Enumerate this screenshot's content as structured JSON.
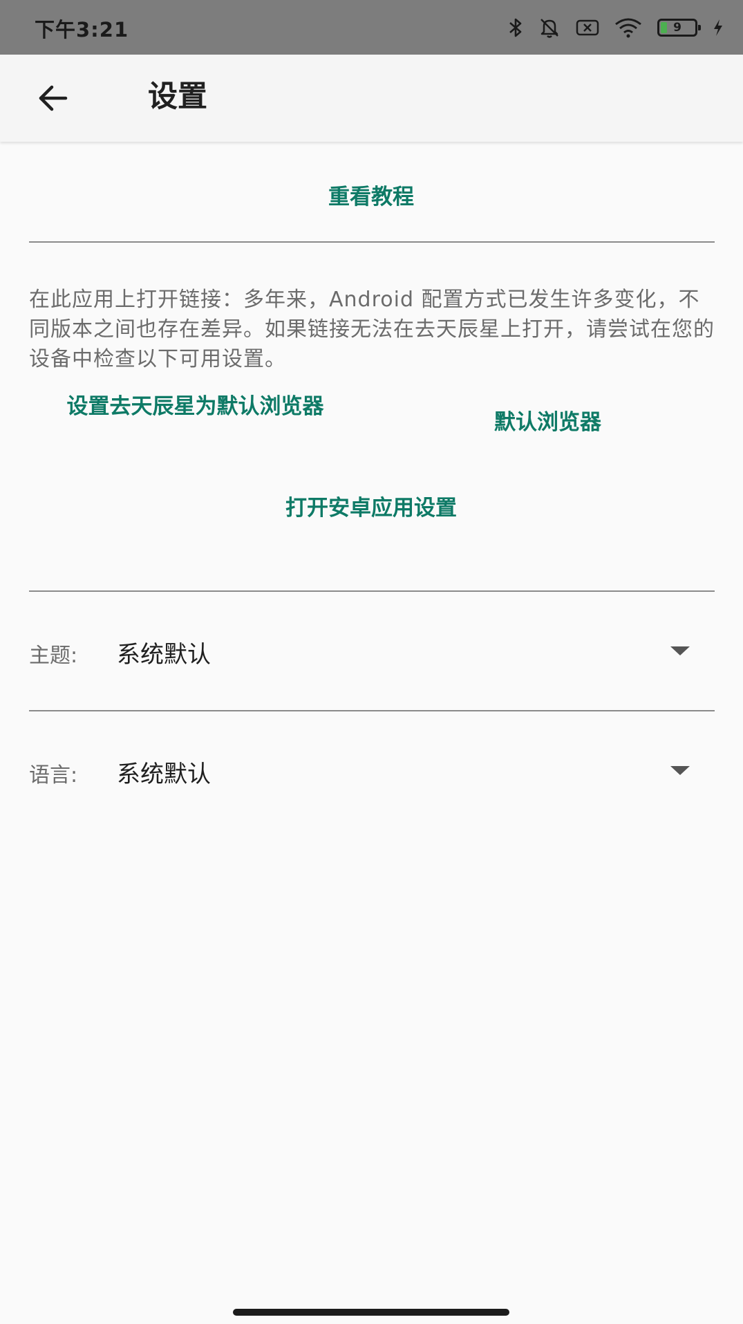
{
  "status_bar": {
    "time": "下午3:21",
    "battery_level": "9",
    "icons": [
      "bluetooth-icon",
      "bell-off-icon",
      "sim-off-icon",
      "wifi-icon",
      "battery-icon",
      "charging-icon"
    ]
  },
  "app_bar": {
    "back_icon": "arrow-left-icon",
    "title": "设置"
  },
  "actions": {
    "rewatch_tutorial": "重看教程",
    "set_default_browser": "设置去天辰星为默认浏览器",
    "default_browser": "默认浏览器",
    "open_android_settings": "打开安卓应用设置"
  },
  "info_text": "在此应用上打开链接：多年来，Android 配置方式已发生许多变化，不同版本之间也存在差异。如果链接无法在去天辰星上打开，请尝试在您的设备中检查以下可用设置。",
  "theme": {
    "label": "主题:",
    "value": "系统默认"
  },
  "language": {
    "label": "语言:",
    "value": "系统默认"
  },
  "colors": {
    "accent": "#0e7a66",
    "background": "#fafafa",
    "status_bar": "#7d7d7d",
    "battery_fill": "#4caf50"
  }
}
